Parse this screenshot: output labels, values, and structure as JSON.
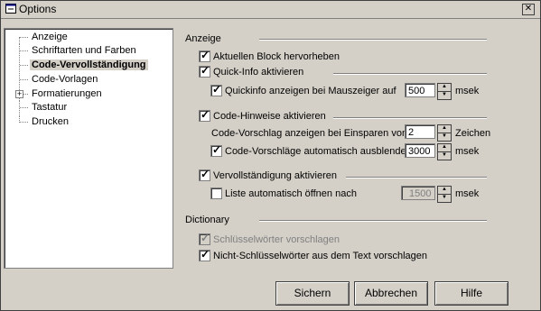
{
  "window": {
    "title": "Options"
  },
  "tree": {
    "items": [
      {
        "label": "Anzeige"
      },
      {
        "label": "Schriftarten und Farben"
      },
      {
        "label": "Code-Vervollständigung"
      },
      {
        "label": "Code-Vorlagen"
      },
      {
        "label": "Formatierungen"
      },
      {
        "label": "Tastatur"
      },
      {
        "label": "Drucken"
      }
    ],
    "selected": "Code-Vervollständigung"
  },
  "sections": {
    "anzeige": "Anzeige",
    "dictionary": "Dictionary"
  },
  "options": {
    "aktuellen_block": {
      "label": "Aktuellen Block hervorheben",
      "checked": true
    },
    "quick_info": {
      "label": "Quick-Info aktivieren",
      "checked": true
    },
    "quickinfo_maus": {
      "label": "Quickinfo anzeigen bei Mauszeiger auf",
      "checked": true,
      "value": "500",
      "unit": "msek"
    },
    "code_hinweise": {
      "label": "Code-Hinweise aktivieren",
      "checked": true
    },
    "code_vorschlag": {
      "label": "Code-Vorschlag anzeigen bei Einsparen von",
      "value": "2",
      "unit": "Zeichen"
    },
    "code_ausblenden": {
      "label": "Code-Vorschläge automatisch ausblende...",
      "checked": true,
      "value": "3000",
      "unit": "msek"
    },
    "vervollstaendigung": {
      "label": "Vervollständigung aktivieren",
      "checked": true
    },
    "liste_oeffnen": {
      "label": "Liste automatisch öffnen nach",
      "checked": false,
      "value": "1500",
      "unit": "msek"
    },
    "schluesselwoerter": {
      "label": "Schlüsselwörter vorschlagen",
      "checked": true,
      "disabled": true
    },
    "nicht_schluesselwoerter": {
      "label": "Nicht-Schlüsselwörter aus dem Text vorschlagen",
      "checked": true
    }
  },
  "buttons": {
    "ok": "Sichern",
    "cancel": "Abbrechen",
    "help": "Hilfe"
  },
  "glyphs": {
    "check": "✓",
    "up": "▲",
    "down": "▼",
    "close": "✕",
    "plus": "+"
  }
}
